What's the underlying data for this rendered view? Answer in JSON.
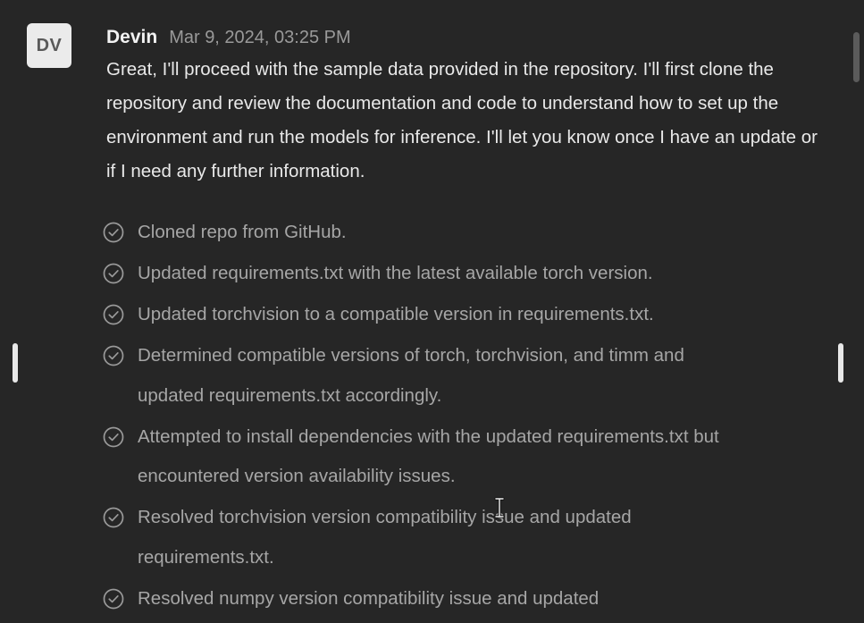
{
  "message": {
    "avatar_initials": "DV",
    "author": "Devin",
    "timestamp": "Mar 9, 2024, 03:25 PM",
    "body": "Great, I'll proceed with the sample data provided in the repository. I'll first clone the repository and review the documentation and code to understand how to set up the environment and run the models for inference. I'll let you know once I have an update or if I need any further information."
  },
  "steps": [
    {
      "text": "Cloned repo from GitHub.",
      "icon": "check-circle-icon",
      "status": "done"
    },
    {
      "text": "Updated requirements.txt with the latest available torch version.",
      "icon": "check-circle-icon",
      "status": "done"
    },
    {
      "text": "Updated torchvision to a compatible version in requirements.txt.",
      "icon": "check-circle-icon",
      "status": "done"
    },
    {
      "text": "Determined compatible versions of torch, torchvision, and timm and updated requirements.txt accordingly.",
      "icon": "check-circle-icon",
      "status": "done"
    },
    {
      "text": "Attempted to install dependencies with the updated requirements.txt but encountered version availability issues.",
      "icon": "check-circle-icon",
      "status": "done"
    },
    {
      "text": "Resolved torchvision version compatibility issue and updated requirements.txt.",
      "icon": "check-circle-icon",
      "status": "done"
    },
    {
      "text": "Resolved numpy version compatibility issue and updated",
      "icon": "check-circle-icon",
      "status": "done"
    }
  ],
  "colors": {
    "background": "#262626",
    "author": "#f2f2f2",
    "body_text": "#e9e9e9",
    "step_text": "#a6a6a6",
    "timestamp": "#9a9a9a"
  }
}
